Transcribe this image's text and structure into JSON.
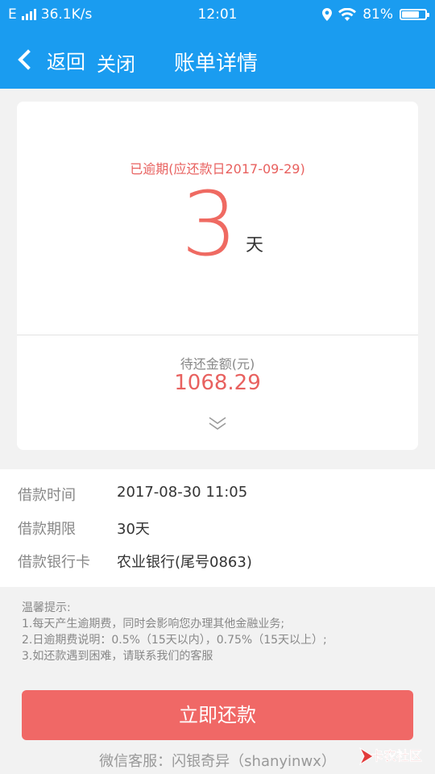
{
  "status_bar": {
    "network_type": "E",
    "speed": "36.1K/s",
    "time": "12:01",
    "battery_percent": "81%",
    "battery_level": 0.81
  },
  "nav": {
    "back_label": "返回",
    "close_label": "关闭",
    "title": "账单详情"
  },
  "bill": {
    "overdue_text": "已逾期(应还款日2017-09-29)",
    "overdue_days": "3",
    "days_unit": "天",
    "due_label": "待还金额(元)",
    "due_amount": "1068.29"
  },
  "loan_info": [
    {
      "label": "借款时间",
      "value": "2017-08-30 11:05"
    },
    {
      "label": "借款期限",
      "value": "30天"
    },
    {
      "label": "借款银行卡",
      "value": "农业银行(尾号0863)"
    }
  ],
  "tips": {
    "title": "温馨提示:",
    "lines": [
      "1.每天产生逾期费，同时会影响您办理其他金融业务;",
      "2.日逾期费说明：0.5%（15天以内），0.75%（15天以上）;",
      "3.如还款遇到困难，请联系我们的客服"
    ]
  },
  "pay_button_label": "立即还款",
  "wechat_service": "微信客服：闪银奇异（shanyinwx）",
  "watermark": "卡农社区",
  "colors": {
    "primary_blue": "#1a9cf0",
    "accent_red": "#f06866"
  }
}
